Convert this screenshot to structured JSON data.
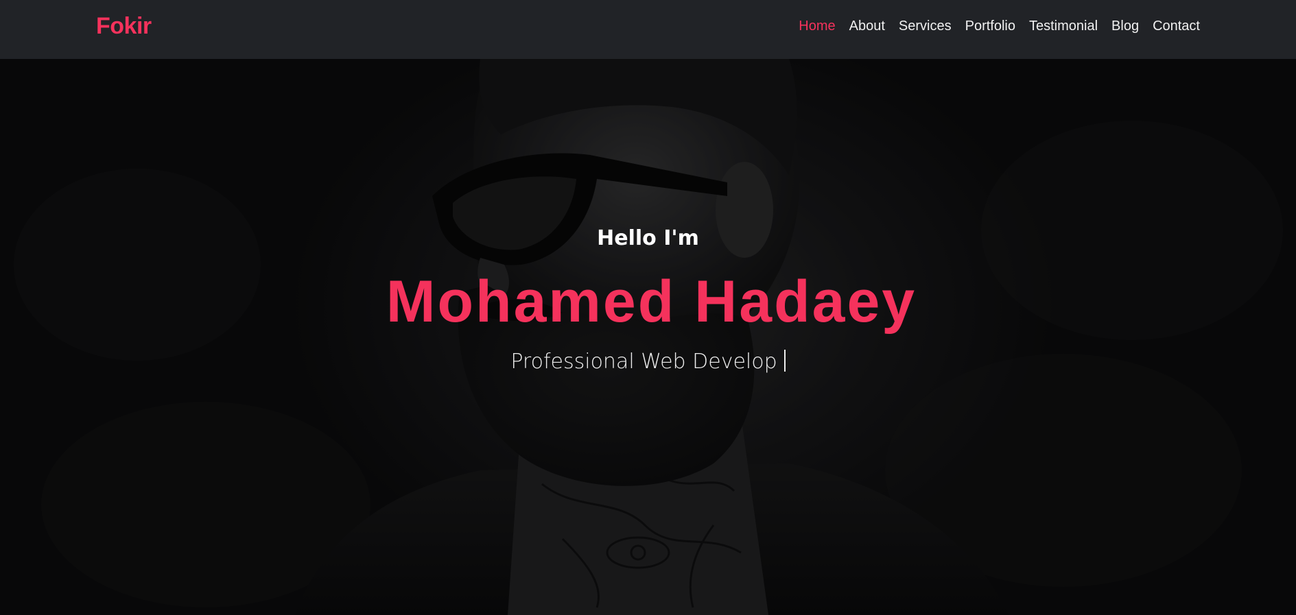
{
  "brand": {
    "name": "Fokir",
    "color": "#f5325c"
  },
  "nav": {
    "items": [
      {
        "label": "Home",
        "active": true
      },
      {
        "label": "About",
        "active": false
      },
      {
        "label": "Services",
        "active": false
      },
      {
        "label": "Portfolio",
        "active": false
      },
      {
        "label": "Testimonial",
        "active": false
      },
      {
        "label": "Blog",
        "active": false
      },
      {
        "label": "Contact",
        "active": false
      }
    ]
  },
  "hero": {
    "greeting": "Hello I'm",
    "name": "Mohamed Hadaey",
    "tagline": "Professional Web Develop",
    "background": "portrait-photo"
  },
  "colors": {
    "accent": "#f5325c",
    "header_bg": "#212327",
    "hero_bg": "#0d0d0e",
    "text": "#ffffff"
  }
}
